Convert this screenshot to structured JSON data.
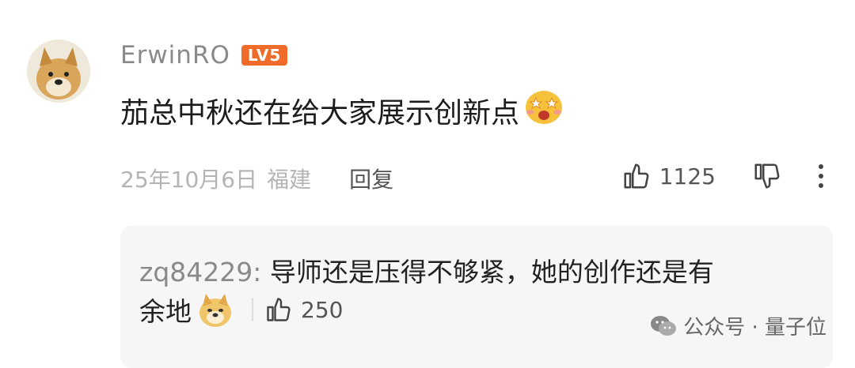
{
  "comment": {
    "username": "ErwinRO",
    "level_badge": "LV5",
    "text": "茄总中秋还在给大家展示创新点",
    "emoji_name": "starry-eyes-emoji",
    "date": "25年10月6日",
    "location": "福建",
    "reply_label": "回复",
    "like_count": "1125"
  },
  "reply": {
    "username": "zq84229:",
    "text_line1": " 导师还是压得不够紧，她的创作还是有",
    "text_line2": "余地",
    "emoji_name": "doge-emoji",
    "like_count": "250"
  },
  "watermark": {
    "text": "公众号 · 量子位",
    "icon": "wechat-icon"
  },
  "colors": {
    "badge": "#f06a2a",
    "muted_text": "#b4b4b4",
    "reply_bg": "#f6f6f6"
  }
}
